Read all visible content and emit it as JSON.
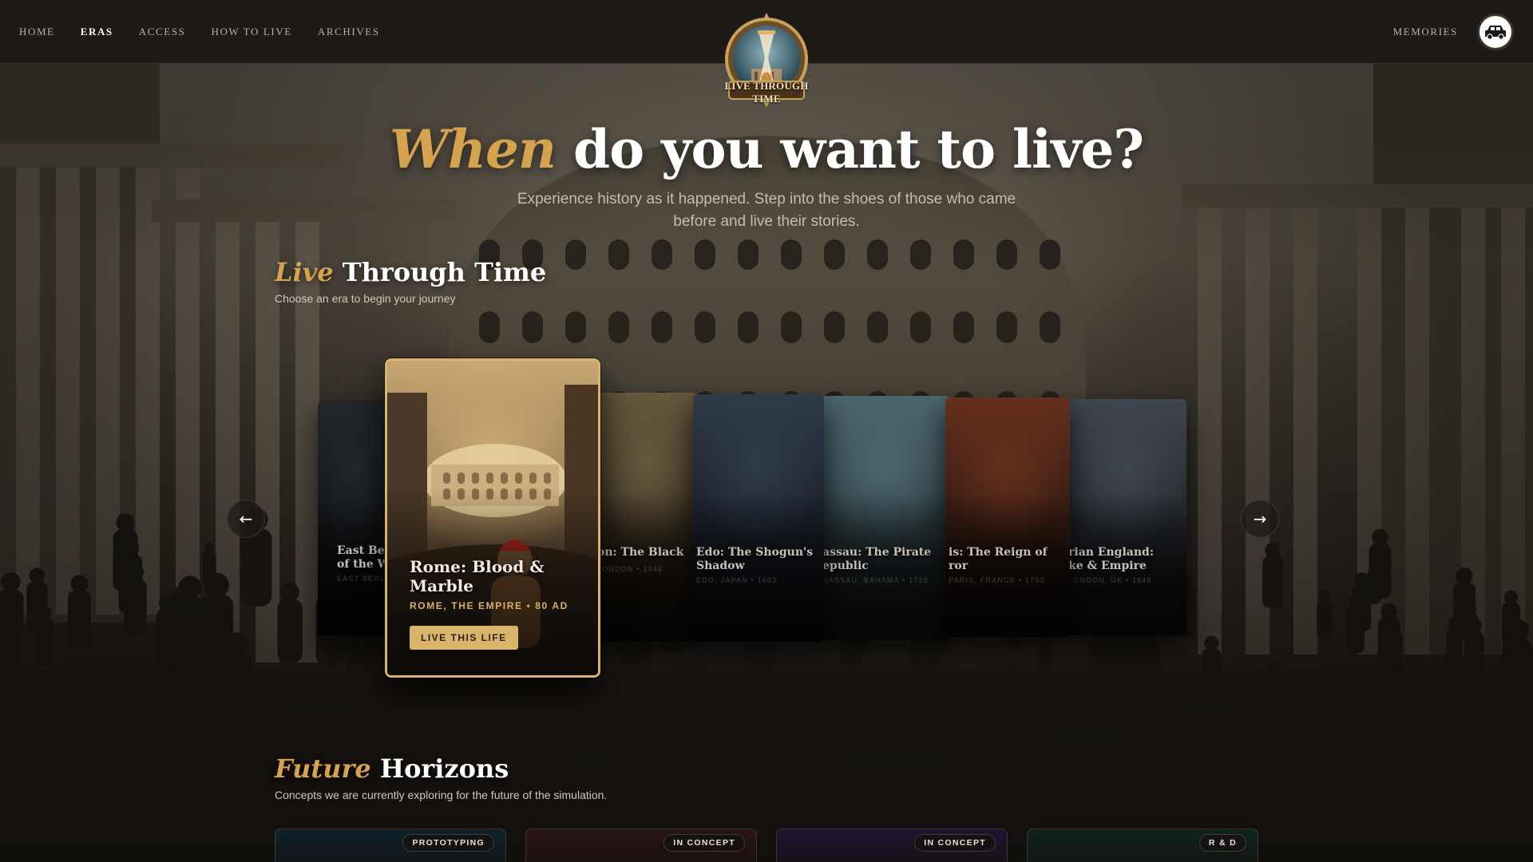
{
  "nav": {
    "links": [
      {
        "label": "HOME",
        "active": false
      },
      {
        "label": "ERAS",
        "active": true
      },
      {
        "label": "ACCESS",
        "active": false
      },
      {
        "label": "HOW TO LIVE",
        "active": false
      },
      {
        "label": "ARCHIVES",
        "active": false
      }
    ],
    "memories_label": "MEMORIES",
    "avatar_icon": "car-icon"
  },
  "logo": {
    "text": "LIVE THROUGH TIME",
    "icon": "hourglass-icon"
  },
  "hero": {
    "title_accent": "When",
    "title_rest": " do you want to live?",
    "subtitle": "Experience history as it happened. Step into the shoes of those who came before and live their stories."
  },
  "live_section": {
    "title_accent": "Live",
    "title_rest": " Through Time",
    "subtitle": "Choose an era to begin your journey"
  },
  "carousel": {
    "prev_icon": "←",
    "next_icon": "→",
    "cards": [
      {
        "title": "East Ber",
        "title2": "of the W",
        "meta": "EAST BERLI",
        "palette": [
          "#2a2e33",
          "#0c0e10"
        ]
      },
      {
        "title": "Rome: Blood & Marble",
        "meta": "ROME, THE EMPIRE • 80 AD",
        "button": "LIVE THIS LIFE",
        "palette": [
          "#c9a872",
          "#3b2a1c"
        ]
      },
      {
        "title": "on: The Black",
        "meta": "LONDON • 1348",
        "palette": [
          "#7d6a4a",
          "#1c160f"
        ]
      },
      {
        "title": "Edo: The Shogun's",
        "title2": "Shadow",
        "meta": "EDO, JAPAN • 1603",
        "palette": [
          "#3a4658",
          "#0f1218"
        ]
      },
      {
        "title": "assau: The Pirate",
        "title2": "epublic",
        "meta": "NASSAU, BAHAMA • 1715",
        "palette": [
          "#5b7d86",
          "#1d2224"
        ]
      },
      {
        "title": "is: The Reign of",
        "title2": "ror",
        "meta": "PARIS, FRANCE • 1793",
        "palette": [
          "#7a3a22",
          "#160f0d"
        ]
      },
      {
        "title": "rian England:",
        "title2": "ke & Empire",
        "meta": "LONDON, UK • 1848",
        "palette": [
          "#4e5560",
          "#15171a"
        ]
      }
    ]
  },
  "future_section": {
    "title_accent": "Future",
    "title_rest": " Horizons",
    "subtitle": "Concepts we are currently exploring for the future of the simulation.",
    "cards": [
      {
        "badge": "PROTOTYPING",
        "tint": "#10222a"
      },
      {
        "badge": "IN CONCEPT",
        "tint": "#2a1416"
      },
      {
        "badge": "IN CONCEPT",
        "tint": "#1d1430"
      },
      {
        "badge": "R & D",
        "tint": "#10241e"
      }
    ]
  }
}
